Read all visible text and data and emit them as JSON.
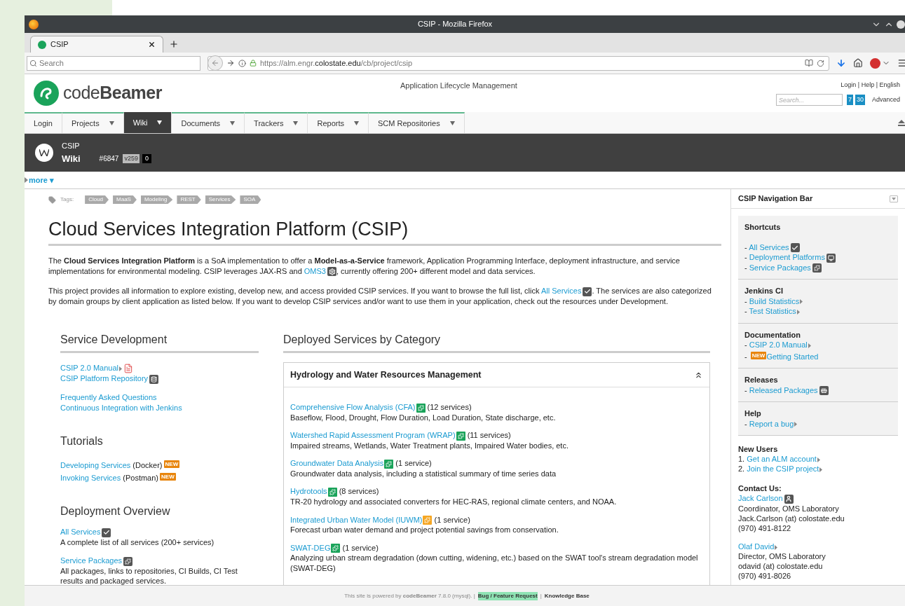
{
  "window": {
    "title": "CSIP - Mozilla Firefox"
  },
  "browser": {
    "tabs": [
      {
        "label": "CSIP",
        "selected": true
      }
    ],
    "search": {
      "placeholder": "Search"
    },
    "url_prefix": "https://alm.engr.",
    "url_domain": "colostate.edu",
    "url_path": "/cb/project/csip"
  },
  "app_header": {
    "logo": "code**Beamer**",
    "tagline": "Application Lifecycle Management",
    "top_links": "Login | Help | English",
    "search": {
      "placeholder": "Search..."
    },
    "calendar_badges": [
      "7",
      "30"
    ],
    "advanced": "Advanced"
  },
  "menu": [
    {
      "label": "Login",
      "has_menu": false,
      "selected": false
    },
    {
      "label": "Projects",
      "has_menu": true,
      "selected": false
    },
    {
      "label": "Wiki",
      "has_menu": true,
      "selected": true
    },
    {
      "label": "Documents",
      "has_menu": true,
      "selected": false
    },
    {
      "label": "Trackers",
      "has_menu": true,
      "selected": false
    },
    {
      "label": "Reports",
      "has_menu": true,
      "selected": false
    },
    {
      "label": "SCM Repositories",
      "has_menu": true,
      "selected": false
    }
  ],
  "context": {
    "project": "CSIP",
    "section": "Wiki",
    "id": "#6847",
    "version": "v259",
    "count": "0"
  },
  "more": "more ▾",
  "tags_label": "Tags:",
  "tags": [
    "Cloud",
    "MaaS",
    "Modeling",
    "REST",
    "Services",
    "SOA"
  ],
  "page_title": "Cloud Services Integration Platform (CSIP)",
  "intro": [
    [
      {
        "is_link": false,
        "text": "The **Cloud Services Integration Platform** is a SoA implementation to offer a **Model-as-a-Service** framework, Application Programming Interface, deployment infrastructure, and service implementations for environmental modeling. CSIP leverages JAX-RS and "
      },
      {
        "is_link": true,
        "text": "OMS3",
        "kind": "gear"
      },
      {
        "is_link": false,
        "text": ", currently offering 200+ different model and data services."
      }
    ],
    [
      {
        "is_link": false,
        "text": "This project provides all information to explore existing, develop new, and access provided CSIP services. If you want to browse the full list, click "
      },
      {
        "is_link": true,
        "text": "All Services",
        "kind": "check"
      },
      {
        "is_link": false,
        "text": ". The services are also categorized by domain groups by client application as listed below. If you want to develop CSIP services and/or want to use them in your application, check out the resources under Development."
      }
    ]
  ],
  "left_sections": [
    {
      "heading": "Service Development",
      "groups": [
        [
          {
            "link": "CSIP 2.0 Manual",
            "kind": "arrow_pdf"
          },
          {
            "link": "CSIP Platform Repository",
            "kind": "database"
          }
        ],
        [
          {
            "link": "Frequently Asked Questions",
            "kind": "plain"
          },
          {
            "link": "Continuous Integration with Jenkins",
            "kind": "plain"
          }
        ]
      ]
    },
    {
      "heading": "Tutorials",
      "groups": [
        [
          {
            "link": "Developing Services",
            "note": "(Docker)",
            "badge": "NEW",
            "kind": "plain"
          },
          {
            "link": "Invoking Services",
            "note": "(Postman)",
            "badge": "NEW",
            "kind": "plain"
          }
        ]
      ]
    },
    {
      "heading": "Deployment Overview",
      "groups": [
        [
          {
            "link": "All Services",
            "kind": "check",
            "description": "A complete list of all services (200+ services)"
          }
        ],
        [
          {
            "link": "Service Packages",
            "kind": "puzzle",
            "description": "All packages, links to repositories, CI Builds, CI Test results and packaged services."
          }
        ]
      ]
    }
  ],
  "deployed": {
    "heading": "Deployed Services by Category",
    "panel": {
      "title": "Hydrology and Water Resources Management",
      "expanded": true,
      "services": [
        {
          "name": "Comprehensive Flow Analysis (CFA)",
          "color": "#1aa35a",
          "count": "(12 services)",
          "description": "Baseflow, Flood, Drought, Flow Duration, Load Duration, State discharge, etc."
        },
        {
          "name": "Watershed Rapid Assessment Program (WRAP)",
          "color": "#1aa35a",
          "count": "(11 services)",
          "description": "Impaired streams, Wetlands, Water Treatment plants, Impaired Water bodies, etc."
        },
        {
          "name": "Groundwater Data Analysis",
          "color": "#1aa35a",
          "count": "(1 service)",
          "description": "Groundwater data analysis, including a statistical summary of time series data"
        },
        {
          "name": "Hydrotools",
          "color": "#1aa35a",
          "count": "(8 services)",
          "description": "TR-20 hydrology and associated converters for HEC-RAS, regional climate centers, and NOAA."
        },
        {
          "name": "Integrated Urban Water Model (IUWM)",
          "color": "#f5a623",
          "count": "(1 service)",
          "description": "Forecast urban water demand and project potential savings from conservation."
        },
        {
          "name": "SWAT-DEG",
          "color": "#1aa35a",
          "count": "(1 service)",
          "description": "Analyzing urban stream degradation (down cutting, widening, etc.) based on the SWAT tool's stream degradation model (SWAT-DEG)"
        }
      ]
    }
  },
  "sidebar": {
    "title": "CSIP Navigation Bar",
    "panels": [
      {
        "heading": "Shortcuts",
        "items": [
          {
            "marker": "-",
            "link": "All Services",
            "kind": "check"
          },
          {
            "marker": "-",
            "link": "Deployment Platforms",
            "kind": "monitor"
          },
          {
            "marker": "-",
            "link": "Service Packages",
            "kind": "puzzle"
          }
        ]
      },
      {
        "heading": "Jenkins CI",
        "items": [
          {
            "marker": "-",
            "link": "Build Statistics",
            "kind": "arrow"
          },
          {
            "marker": "-",
            "link": "Test Statistics",
            "kind": "arrow"
          }
        ]
      },
      {
        "heading": "Documentation",
        "items": [
          {
            "marker": "-",
            "link": "CSIP 2.0 Manual",
            "kind": "arrow"
          },
          {
            "marker": "-",
            "badge": "NEW",
            "link": "Getting Started",
            "kind": "plain"
          }
        ]
      },
      {
        "heading": "Releases",
        "items": [
          {
            "marker": "-",
            "link": "Released Packages",
            "kind": "bus"
          }
        ]
      },
      {
        "heading": "Help",
        "items": [
          {
            "marker": "-",
            "link": "Report a bug",
            "kind": "arrow"
          }
        ]
      }
    ],
    "new_users": {
      "heading": "New Users",
      "items": [
        {
          "marker": "1.",
          "link": "Get an ALM account",
          "kind": "arrow"
        },
        {
          "marker": "2.",
          "link": "Join the CSIP project",
          "kind": "arrow"
        }
      ]
    },
    "contact": {
      "heading": "Contact Us:",
      "people": [
        {
          "name": "Jack Carlson",
          "kind": "person",
          "lines": [
            "Coordinator, OMS Laboratory",
            "Jack.Carlson (at) colostate.edu",
            "(970) 491-8122"
          ]
        },
        {
          "name": "Olaf David",
          "kind": "arrow",
          "lines": [
            "Director, OMS Laboratory",
            "odavid (at) colostate.edu",
            "(970) 491-8026"
          ]
        }
      ]
    }
  },
  "footer": {
    "text": "This site is powered by **codeBeamer** 7.8.0 (mysql). |",
    "links": [
      {
        "text": "Bug / Feature Request",
        "highlighted": true
      },
      {
        "text": "Knowledge Base",
        "highlighted": false
      }
    ],
    "separator": "|"
  }
}
